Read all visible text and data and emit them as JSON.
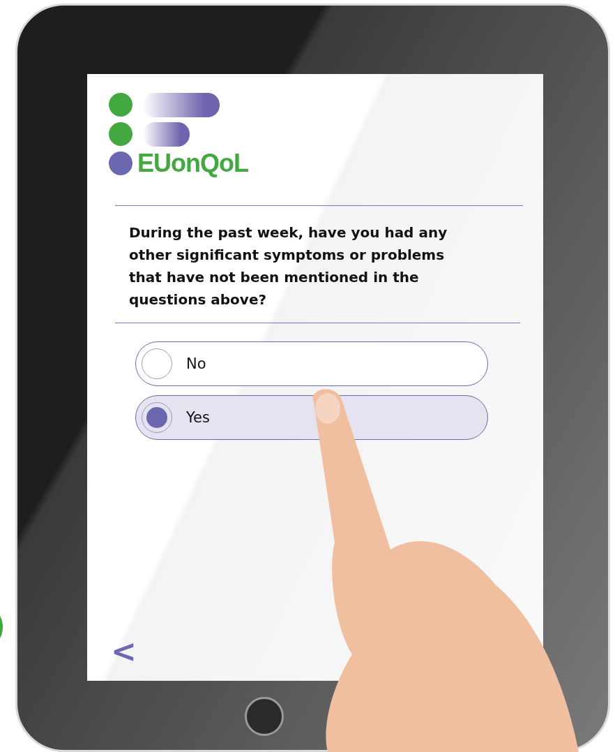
{
  "logo": {
    "text": "EUonQoL"
  },
  "question": "During the past week, have you had any other significant symptoms or problems that have not been mentioned in the questions above?",
  "options": [
    {
      "label": "No",
      "selected": false
    },
    {
      "label": "Yes",
      "selected": true
    }
  ],
  "back_button": "<"
}
